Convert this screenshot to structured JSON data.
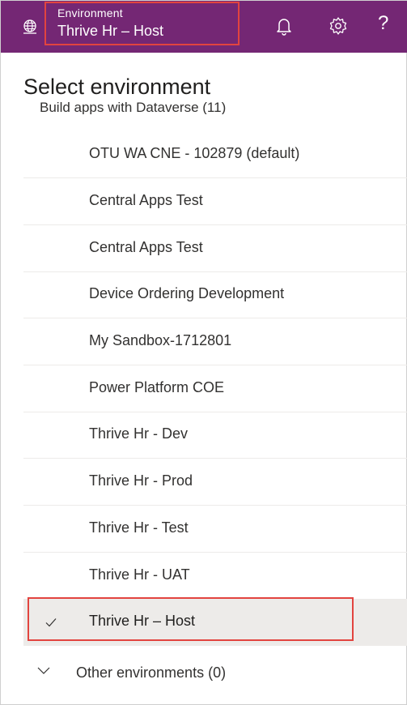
{
  "header": {
    "caption": "Environment",
    "current_environment": "Thrive Hr – Host",
    "icons": [
      "globe-icon",
      "bell-icon",
      "gear-icon",
      "help-icon"
    ],
    "help_glyph": "?"
  },
  "panel": {
    "title": "Select environment",
    "group_label": "Build apps with Dataverse (11)",
    "environments": [
      {
        "label": "OTU WA CNE - 102879 (default)"
      },
      {
        "label": "Central Apps Test"
      },
      {
        "label": "Central Apps Test"
      },
      {
        "label": "Device Ordering Development"
      },
      {
        "label": "My Sandbox-1712801"
      },
      {
        "label": "Power Platform COE"
      },
      {
        "label": "Thrive Hr - Dev"
      },
      {
        "label": "Thrive Hr - Prod"
      },
      {
        "label": "Thrive Hr - Test"
      },
      {
        "label": "Thrive Hr - UAT"
      },
      {
        "label": "Thrive Hr – Host",
        "selected": true
      }
    ],
    "other_group_label": "Other environments (0)"
  },
  "colors": {
    "brand": "#742774",
    "highlight_border": "#e2443f",
    "selected_row": "#edebe9"
  }
}
